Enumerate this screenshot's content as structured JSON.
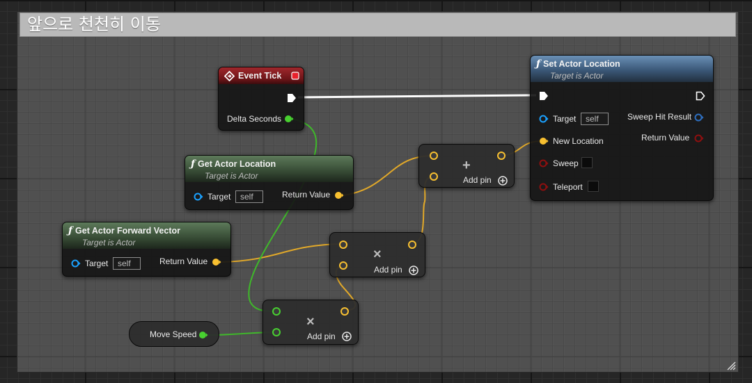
{
  "comment": {
    "title": "앞으로 천천히 이동"
  },
  "colors": {
    "exec_wire": "#ffffff",
    "vector_pin": "#f8c030",
    "float_pin": "#48d030",
    "object_pin": "#1aa1ff",
    "struct_pin": "#2e6fc0",
    "bool_pin": "#8e0f0f"
  },
  "nodes": {
    "event_tick": {
      "title": "Event Tick",
      "pin_delta": "Delta Seconds"
    },
    "get_actor_location": {
      "title": "Get Actor Location",
      "subtitle": "Target is Actor",
      "pin_target": "Target",
      "target_value": "self",
      "pin_return": "Return Value"
    },
    "get_actor_forward_vector": {
      "title": "Get Actor Forward Vector",
      "subtitle": "Target is Actor",
      "pin_target": "Target",
      "target_value": "self",
      "pin_return": "Return Value"
    },
    "set_actor_location": {
      "title": "Set Actor Location",
      "subtitle": "Target is Actor",
      "pin_target": "Target",
      "target_value": "self",
      "pin_new_location": "New Location",
      "pin_sweep": "Sweep",
      "pin_teleport": "Teleport",
      "pin_sweep_hit": "Sweep Hit Result",
      "pin_return": "Return Value"
    },
    "add_vector": {
      "symbol": "+",
      "add_pin": "Add pin"
    },
    "multiply_vector": {
      "symbol": "×",
      "add_pin": "Add pin"
    },
    "multiply_float": {
      "symbol": "×",
      "add_pin": "Add pin"
    },
    "move_speed": {
      "label": "Move Speed"
    }
  }
}
